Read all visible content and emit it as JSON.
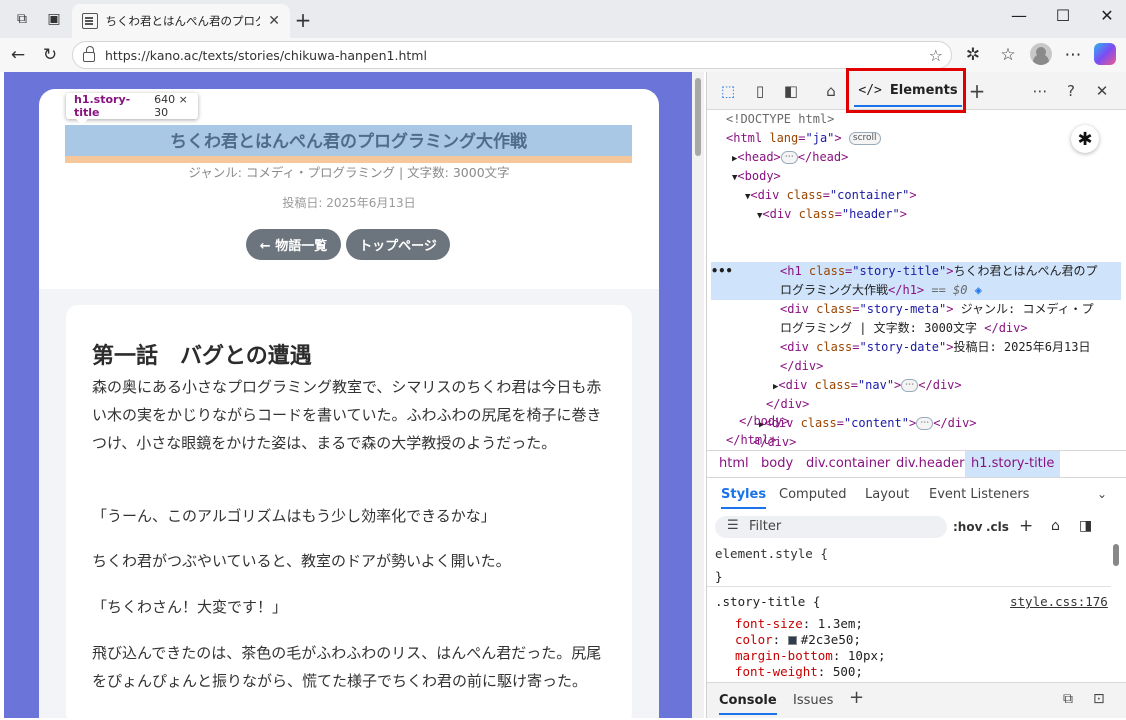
{
  "browser": {
    "tab_title": "ちくわ君とはんぺん君のプログラミング大",
    "url": "https://kano.ac/texts/stories/chikuwa-hanpen1.html",
    "new_tab_glyph": "+"
  },
  "page": {
    "tooltip": {
      "selector": "h1.story-title",
      "dims": "640 × 30"
    },
    "title": "ちくわ君とはんぺん君のプログラミング大作戦",
    "meta": "ジャンル: コメディ・プログラミング | 文字数: 3000文字",
    "date": "投稿日: 2025年6月13日",
    "buttons": {
      "back": "← 物語一覧",
      "top": "トップページ"
    },
    "chapter": "第一話　バグとの遭遇",
    "paragraphs": [
      "森の奥にある小さなプログラミング教室で、シマリスのちくわ君は今日も赤い木の実をかじりながらコードを書いていた。ふわふわの尻尾を椅子に巻きつけ、小さな眼鏡をかけた姿は、まるで森の大学教授のようだった。",
      "「うーん、このアルゴリズムはもう少し効率化できるかな」",
      "ちくわ君がつぶやいていると、教室のドアが勢いよく開いた。",
      "「ちくわさん！大変です！」",
      "飛び込んできたのは、茶色の毛がふわふわのリス、はんぺん君だった。尻尾をぴょんぴょんと振りながら、慌てた様子でちくわ君の前に駆け寄った。"
    ]
  },
  "devtools": {
    "elements_tab": "Elements",
    "tree": {
      "doctype": "<!DOCTYPE html>",
      "html_open_tag": "<html",
      "html_lang_attr": "lang",
      "html_lang_val": "\"ja\"",
      "close_bracket": ">",
      "scroll_badge": "scroll",
      "head_open": "<head>",
      "head_close": "</head>",
      "ellipsis": "⋯",
      "body_open": "<body>",
      "div_tag": "<div",
      "class_attr": "class",
      "container_val": "\"container\"",
      "header_val": "\"header\"",
      "h1_tag": "<h1",
      "story_title_val": "\"story-title\"",
      "h1_text_1": "ちくわ君とはんぺん君のプ",
      "h1_text_2": "ログラミング大作戦",
      "h1_close": "</h1>",
      "dollar0": "== $0",
      "story_meta_val": "\"story-meta\"",
      "meta_text_1": " ジャンル: コメディ・プ",
      "meta_text_2": "ログラミング | 文字数: 3000文字 ",
      "div_close": "</div>",
      "story_date_val": "\"story-date\"",
      "date_text": "投稿日: 2025年6月13日",
      "nav_val": "\"nav\"",
      "content_val": "\"content\"",
      "body_close": "</body>",
      "html_close": "</html>",
      "row_dots": "•••"
    },
    "breadcrumbs": [
      "html",
      "body",
      "div.container",
      "div.header",
      "h1.story-title"
    ],
    "sub_tabs": [
      "Styles",
      "Computed",
      "Layout",
      "Event Listeners"
    ],
    "filter_placeholder": "Filter",
    "filter_tools": {
      "hov": ":hov",
      "cls": ".cls"
    },
    "styles": {
      "element_style": "element.style {",
      "close_brace": "}",
      "rule_selector": ".story-title {",
      "rule_source": "style.css:176",
      "props": [
        {
          "name": "font-size",
          "value": "1.3em;"
        },
        {
          "name": "color",
          "value": "#2c3e50;"
        },
        {
          "name": "margin-bottom",
          "value": "10px;"
        },
        {
          "name": "font-weight",
          "value": "500;"
        }
      ]
    },
    "bottom_tabs": [
      "Console",
      "Issues"
    ]
  },
  "colors": {
    "page_bg": "#6b74d9",
    "title_color": "#2c3e50",
    "highlight": "#a9c8e6",
    "accent": "#1a73e8"
  }
}
